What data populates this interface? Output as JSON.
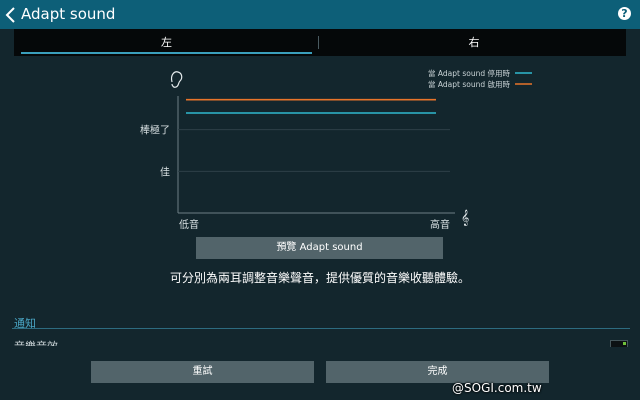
{
  "header": {
    "title": "Adapt sound",
    "back_icon": "chevron-left-icon",
    "help_icon": "question-mark-icon",
    "help_label": "?"
  },
  "tabs": [
    {
      "label": "左",
      "selected": true
    },
    {
      "label": "右",
      "selected": false
    }
  ],
  "chart_data": {
    "type": "line",
    "xlabel": "",
    "ylabel": "",
    "x_tick_labels": [
      "低音",
      "高音"
    ],
    "y_tick_labels": [
      "佳",
      "棒極了"
    ],
    "y_levels": [
      1,
      2
    ],
    "ylim": [
      0,
      3
    ],
    "series": [
      {
        "name": "當 Adapt sound 停用時",
        "color": "#2fb8cf",
        "values": [
          2.4,
          2.4
        ]
      },
      {
        "name": "當 Adapt sound 啟用時",
        "color": "#e8742a",
        "values": [
          2.72,
          2.72
        ]
      }
    ],
    "legend_position": "top-right",
    "grid": true,
    "y_axis_icon": "ear-icon",
    "x_axis_icon": "treble-clef-icon"
  },
  "preview_button": {
    "label": "預覽 Adapt sound"
  },
  "description": "可分別為兩耳調整音樂聲音，提供優質的音樂收聽體驗。",
  "section": {
    "title": "通知",
    "item_label": "音樂音效",
    "item_checked": true
  },
  "buttons": {
    "reset": "重試",
    "done": "完成"
  },
  "watermark": "@SOGI.com.tw",
  "colors": {
    "actionbar": "#0d5f78",
    "background": "#13262d",
    "accent": "#3a9fbc",
    "off_line": "#2fb8cf",
    "on_line": "#e8742a"
  }
}
